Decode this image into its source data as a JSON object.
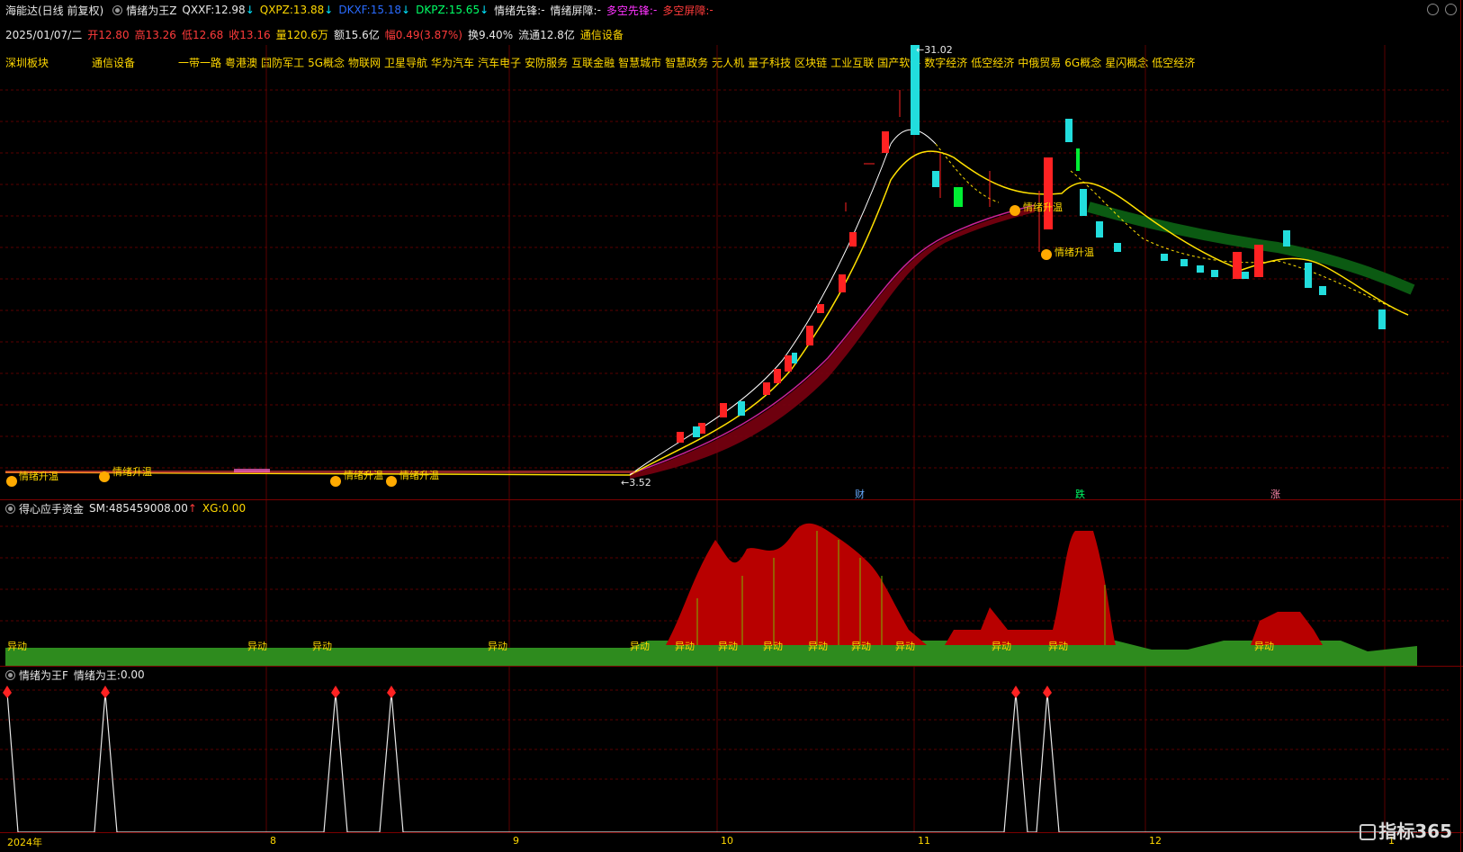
{
  "header": {
    "app_title": "海能达(日线 前复权)",
    "indicator_name": "情绪为王Z",
    "qxxf_label": "QXXF:",
    "qxxf_value": "12.98",
    "qxpz_label": "QXPZ:",
    "qxpz_value": "13.88",
    "dkxf_label": "DKXF:",
    "dkxf_value": "15.18",
    "dkpz_label": "DKPZ:",
    "dkpz_value": "15.65",
    "qxxf_tag": "情绪先锋:",
    "qxxf_tag_val": "-",
    "qxpz_tag": "情绪屏障:",
    "qxpz_tag_val": "-",
    "dkxf_tag": "多空先锋:",
    "dkxf_tag_val": "-",
    "dkpz_tag": "多空屏障:",
    "dkpz_tag_val": "-"
  },
  "quote": {
    "date": "2025/01/07/二",
    "open": "开12.80",
    "high": "高13.26",
    "low": "低12.68",
    "close": "收13.16",
    "volume": "量120.6万",
    "amount": "额15.6亿",
    "change": "幅0.49(3.87%)",
    "turnover": "换9.40%",
    "float": "流通12.8亿",
    "industry": "通信设备"
  },
  "sectors": [
    "深圳板块",
    "通信设备",
    "一带一路",
    "粤港澳",
    "国防军工",
    "5G概念",
    "物联网",
    "卫星导航",
    "华为汽车",
    "汽车电子",
    "安防服务",
    "互联金融",
    "智慧城市",
    "智慧政务",
    "无人机",
    "量子科技",
    "区块链",
    "工业互联",
    "国产软件",
    "数字经济",
    "低空经济",
    "中俄贸易",
    "6G概念",
    "星闪概念",
    "低空经济"
  ],
  "main_chart": {
    "max_label": "31.02",
    "min_label": "3.52",
    "signal_label": "情绪升温",
    "event_cai": "财",
    "event_die": "跌",
    "event_zhang": "涨"
  },
  "panel2": {
    "title": "得心应手资金",
    "sm_label": "SM:",
    "sm_value": "485459008.00",
    "xg_label": "XG:",
    "xg_value": "0.00",
    "tag": "异动"
  },
  "panel3": {
    "title": "情绪为王F",
    "value_label": "情绪为王:",
    "value": "0.00"
  },
  "x_axis": {
    "year": "2024年",
    "m8": "8",
    "m9": "9",
    "m10": "10",
    "m11": "11",
    "m12": "12",
    "m1": "1"
  },
  "logo_text": "指标365",
  "colors": {
    "up": "#ff2222",
    "down": "#22dddd",
    "accent": "#ffd800",
    "grid": "#7a0000"
  },
  "chart_data": {
    "type": "candlestick",
    "title": "",
    "ylim": [
      3.52,
      31.02
    ],
    "annotations": [
      "31.02",
      "3.52"
    ]
  }
}
